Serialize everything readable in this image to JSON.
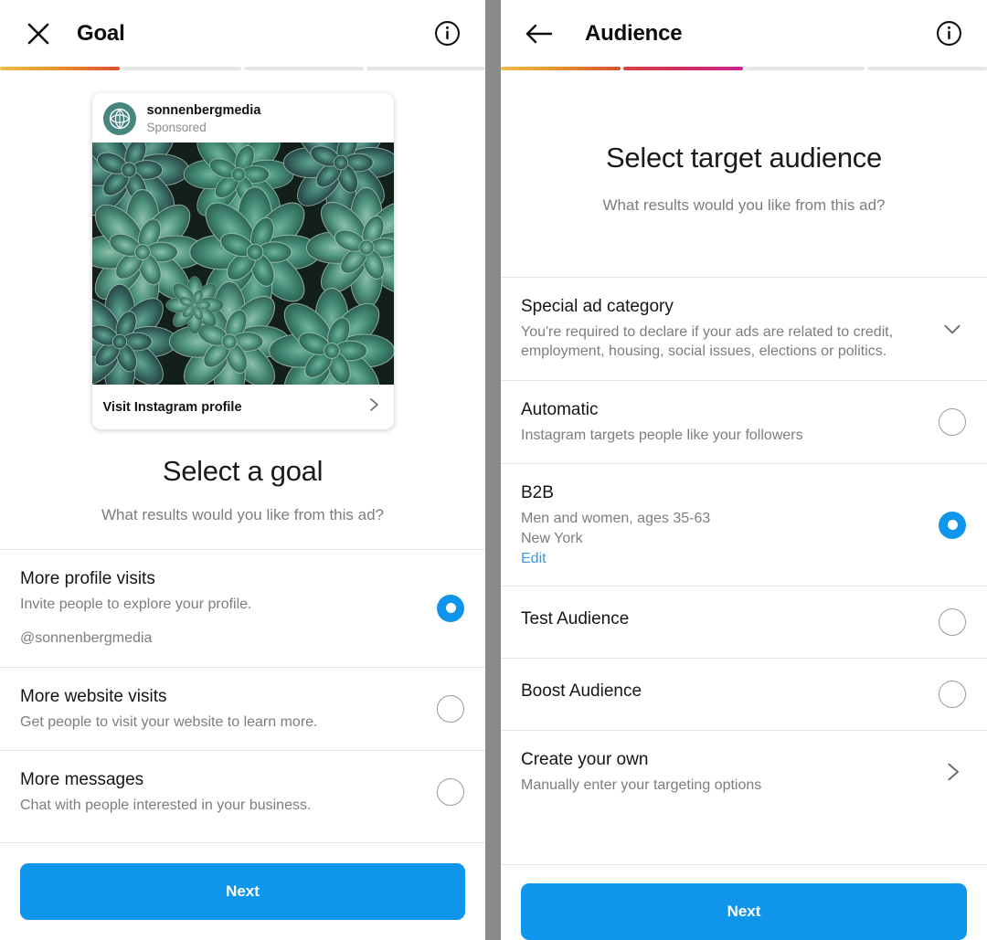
{
  "goal_screen": {
    "header": {
      "close_icon": "close-x-icon",
      "title": "Goal",
      "info_icon": "info-circle-icon"
    },
    "progress": {
      "total_steps": 4,
      "completed_steps": 1
    },
    "ad_preview": {
      "avatar_icon": "sonnenbergmedia-leaf-logo",
      "username": "sonnenbergmedia",
      "label": "Sponsored",
      "photo_alt": "succulent-plants-photo",
      "cta_label": "Visit Instagram profile",
      "cta_chevron": "chevron-right-icon"
    },
    "section": {
      "title": "Select a goal",
      "subtitle": "What results would you like from this ad?"
    },
    "options": [
      {
        "title": "More profile visits",
        "description": "Invite people to explore your profile.",
        "extra": "@sonnenbergmedia",
        "selected": true
      },
      {
        "title": "More website visits",
        "description": "Get people to visit your website to learn more.",
        "selected": false
      },
      {
        "title": "More messages",
        "description": "Chat with people interested in your business.",
        "selected": false
      }
    ],
    "footer": {
      "next_label": "Next"
    }
  },
  "audience_screen": {
    "header": {
      "back_icon": "arrow-left-icon",
      "title": "Audience",
      "info_icon": "info-circle-icon"
    },
    "progress": {
      "total_steps": 4,
      "completed_steps": 2
    },
    "section": {
      "title": "Select target audience",
      "subtitle": "What results would you like from this ad?"
    },
    "special_category": {
      "title": "Special ad category",
      "description": "You're required to declare if your ads are related to credit, employment, housing, social issues, elections or politics.",
      "chevron": "chevron-down-icon"
    },
    "options": [
      {
        "title": "Automatic",
        "description": "Instagram targets people like your followers",
        "selected": false
      },
      {
        "title": "B2B",
        "description": "Men and women, ages 35-63",
        "description2": "New York",
        "link": "Edit",
        "selected": true
      },
      {
        "title": "Test Audience",
        "description": "",
        "selected": false
      },
      {
        "title": "Boost Audience",
        "description": "",
        "selected": false
      }
    ],
    "create_own": {
      "title": "Create your own",
      "description": "Manually enter your targeting options",
      "chevron": "chevron-right-icon"
    },
    "footer": {
      "next_label": "Next"
    }
  },
  "colors": {
    "primary_blue": "#0f95ec",
    "link_blue": "#3897f0",
    "progress_step1_start": "#f0ba4a",
    "progress_step1_end": "#d9502f",
    "progress_step2_start": "#d6433f",
    "progress_step2_end": "#c9258f",
    "progress_inactive": "#e6e6e6",
    "avatar_teal": "#46867f",
    "divider_gray": "#8a8a8a"
  }
}
